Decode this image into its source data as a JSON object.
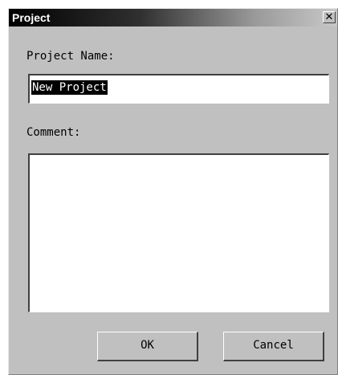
{
  "window": {
    "title": "Project",
    "close_glyph": "✕"
  },
  "form": {
    "project_name_label": "Project Name:",
    "project_name_value": "New Project",
    "comment_label": "Comment:",
    "comment_value": ""
  },
  "buttons": {
    "ok_label": "OK",
    "cancel_label": "Cancel"
  },
  "colors": {
    "dialog_bg": "#c0c0c0",
    "selection_bg": "#000000",
    "selection_fg": "#ffffff"
  }
}
